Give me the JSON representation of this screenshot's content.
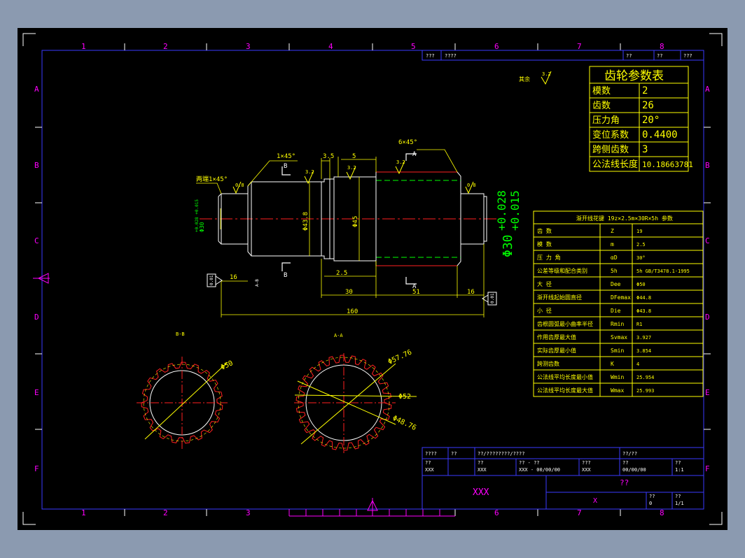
{
  "colors": {
    "background": "#000000",
    "outer": "#8b9ab0",
    "frame": "#3a3aff",
    "text": "#ffff00",
    "grid": "#ff00ff"
  },
  "grid": {
    "columns": [
      "1",
      "2",
      "3",
      "4",
      "5",
      "6",
      "7",
      "8"
    ],
    "rows": [
      "A",
      "B",
      "C",
      "D",
      "E",
      "F"
    ]
  },
  "top_title_strip": {
    "cells": [
      "???",
      "????",
      "??",
      "??",
      "???"
    ]
  },
  "gear_table": {
    "title": "齿轮参数表",
    "rows": [
      {
        "label": "模数",
        "value": "2"
      },
      {
        "label": "齿数",
        "value": "26"
      },
      {
        "label": "压力角",
        "value": "20°"
      },
      {
        "label": "变位系数",
        "value": "0.4400"
      },
      {
        "label": "跨侧齿数",
        "value": "3"
      },
      {
        "label": "公法线长度",
        "value": "10.18663781"
      }
    ]
  },
  "spline_table": {
    "title": "渐开线花键 19z×2.5m×30R×5h 参数",
    "rows": [
      {
        "label": "齿 数",
        "sym": "Z",
        "value": "19"
      },
      {
        "label": "模 数",
        "sym": "m",
        "value": "2.5"
      },
      {
        "label": "压 力 角",
        "sym": "αD",
        "value": "30°"
      },
      {
        "label": "公差等级和配合类别",
        "sym": "5h",
        "value": "5h GB/T3478.1-1995"
      },
      {
        "label": "大 径",
        "sym": "Dee",
        "value": "Φ50"
      },
      {
        "label": "渐开线起始圆直径",
        "sym": "DFemax",
        "value": "Φ44.8"
      },
      {
        "label": "小 径",
        "sym": "Die",
        "value": "Φ43.8"
      },
      {
        "label": "齿根圆弧最小曲率半径",
        "sym": "Rmin",
        "value": "R1"
      },
      {
        "label": "作用齿厚最大值",
        "sym": "Svmax",
        "value": "3.927"
      },
      {
        "label": "实际齿厚最小值",
        "sym": "Smin",
        "value": "3.854"
      },
      {
        "label": "跨测齿数",
        "sym": "K",
        "value": "4"
      },
      {
        "label": "公法线平均长度最小值",
        "sym": "Wmin",
        "value": "25.954"
      },
      {
        "label": "公法线平均长度最大值",
        "sym": "Wmax",
        "value": "25.993"
      }
    ]
  },
  "drawing": {
    "remaining_finish": "其余",
    "roughness": "3.2",
    "roughness_small": "0.8",
    "chamfer_both": "两端1×45°",
    "chamfer_1": "1×45°",
    "chamfer_6": "6×45°",
    "dim_3_5": "3.5",
    "dim_5": "5",
    "dim_16": "16",
    "dim_30": "30",
    "dim_51": "51",
    "dim_160": "160",
    "dim_groove": "2.5",
    "dia_43_8": "Φ43.8",
    "dia_45": "Φ45",
    "dia_30_left": "Φ30",
    "dia_30_right": "Φ30",
    "tol_plus": "+0.028",
    "tol_minus": "+0.015",
    "tol_left": "+0.028 +0.015",
    "section_a": "A",
    "section_b": "B",
    "section_bb": "B-B",
    "section_aa": "A-A",
    "dia_50": "Φ50",
    "dia_57_76": "Φ57.76",
    "dia_52": "Φ52",
    "dia_48_76": "Φ48.76",
    "runout": "0.01",
    "datum": "A-B"
  },
  "title_block": {
    "row1": [
      "????",
      "??",
      "??/????????/????",
      "??/??"
    ],
    "row2_labels": [
      "??",
      "??",
      "?? - ??",
      "???",
      "??",
      "??"
    ],
    "row2_values": [
      "XXX",
      "XXX",
      "XXX - 00/00/00",
      "XXX",
      "00/00/00",
      "1:1"
    ],
    "name": "XXX",
    "drawing_no": "??",
    "material": "X",
    "sheet_label_1": "??",
    "sheet_label_2": "??",
    "sheet_val_1": "0",
    "sheet_val_2": "1/1"
  }
}
